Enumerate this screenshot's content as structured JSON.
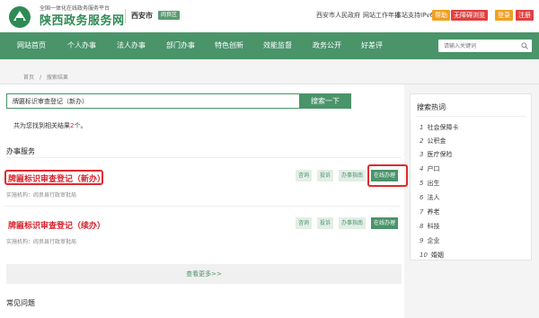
{
  "header": {
    "subtitle": "全国一体化在线政务服务平台",
    "site_name": "陕西政务服务网",
    "city": "西安市",
    "city_switch": "阎良区",
    "links": [
      "西安市人民政府",
      "网站工作年报",
      "本站支持IPv6"
    ],
    "tags": [
      {
        "label": "帮助",
        "color": "#f0a020"
      },
      {
        "label": "无障碍浏览",
        "color": "#e04040"
      },
      {
        "label": "登录",
        "color": "#f0a020"
      },
      {
        "label": "注册",
        "color": "#e04040"
      }
    ]
  },
  "nav": {
    "items": [
      "网站首页",
      "个人办事",
      "法人办事",
      "部门办事",
      "特色创新",
      "效能监督",
      "政务公开",
      "好差评"
    ],
    "search_placeholder": "请输入关键词"
  },
  "breadcrumb": {
    "home": "首页",
    "sep": "/",
    "current": "搜索结果"
  },
  "search": {
    "value": "牌匾标识审查登记（新办）",
    "button": "搜索一下"
  },
  "result_count": {
    "prefix": "共为您找到相关结果",
    "num": "2",
    "suffix": "个。"
  },
  "section_title": "办事服务",
  "services": [
    {
      "title": "牌匾标识审查登记（新办）",
      "org": "实施机构：阎良县行政审批局",
      "actions": [
        "咨询",
        "投诉",
        "办事指南",
        "在线办理"
      ]
    },
    {
      "title": "牌匾标识审查登记（续办）",
      "org": "实施机构：阎良县行政审批局",
      "actions": [
        "咨询",
        "投诉",
        "办事指南",
        "在线办理"
      ]
    }
  ],
  "more": "查看更多>>",
  "section_title2": "常见问题",
  "hot": {
    "title": "搜索热词",
    "items": [
      {
        "idx": "1",
        "label": "社会保障卡"
      },
      {
        "idx": "2",
        "label": "公积金"
      },
      {
        "idx": "3",
        "label": "医疗保险"
      },
      {
        "idx": "4",
        "label": "户口"
      },
      {
        "idx": "5",
        "label": "出生"
      },
      {
        "idx": "6",
        "label": "法人"
      },
      {
        "idx": "7",
        "label": "养老"
      },
      {
        "idx": "8",
        "label": "科技"
      },
      {
        "idx": "9",
        "label": "企业"
      },
      {
        "idx": "10",
        "label": "婚姻"
      }
    ]
  }
}
